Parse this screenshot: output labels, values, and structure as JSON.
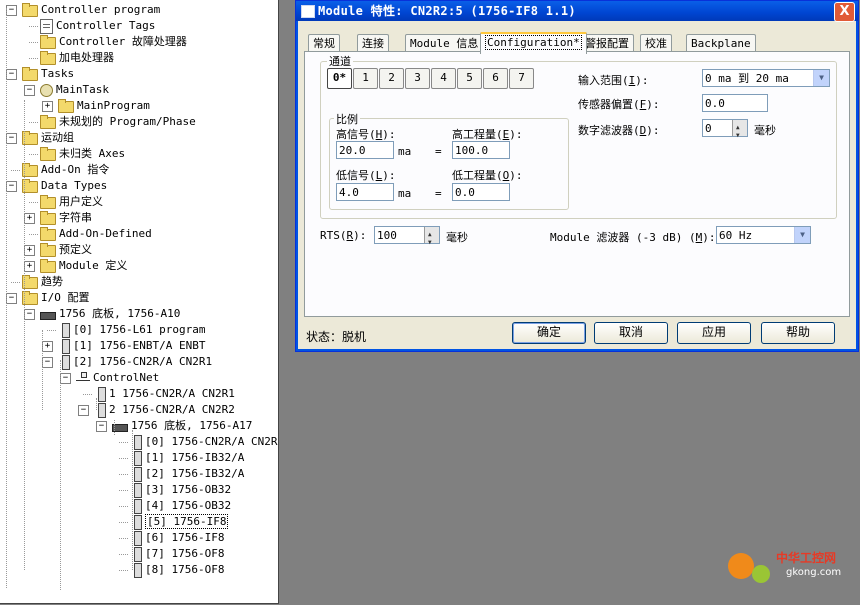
{
  "tree": {
    "items": [
      {
        "label": "Controller program",
        "icon": "folder-icon"
      },
      {
        "label": "Controller Tags",
        "icon": "tags-icon"
      },
      {
        "label": "Controller 故障处理器",
        "icon": "folder-icon"
      },
      {
        "label": "加电处理器",
        "icon": "folder-icon"
      },
      {
        "label": "Tasks",
        "icon": "folder-icon"
      },
      {
        "label": "MainTask",
        "icon": "task-icon"
      },
      {
        "label": "MainProgram",
        "icon": "program-icon"
      },
      {
        "label": "未规划的 Program/Phase",
        "icon": "folder-icon"
      },
      {
        "label": "运动组",
        "icon": "folder-icon"
      },
      {
        "label": "未归类 Axes",
        "icon": "folder-icon"
      },
      {
        "label": "Add-On 指令",
        "icon": "folder-icon"
      },
      {
        "label": "Data Types",
        "icon": "folder-icon"
      },
      {
        "label": "用户定义",
        "icon": "folder-icon"
      },
      {
        "label": "字符串",
        "icon": "folder-icon"
      },
      {
        "label": "Add-On-Defined",
        "icon": "folder-icon"
      },
      {
        "label": "预定义",
        "icon": "folder-icon"
      },
      {
        "label": "Module 定义",
        "icon": "folder-icon"
      },
      {
        "label": "趋势",
        "icon": "folder-icon"
      },
      {
        "label": "I/O 配置",
        "icon": "folder-icon"
      },
      {
        "label": "1756 底板, 1756-A10",
        "icon": "chassis-icon"
      },
      {
        "label": "[0] 1756-L61 program",
        "icon": "module-icon"
      },
      {
        "label": "[1] 1756-ENBT/A ENBT",
        "icon": "module-icon"
      },
      {
        "label": "[2] 1756-CN2R/A CN2R1",
        "icon": "module-icon"
      },
      {
        "label": "ControlNet",
        "icon": "network-icon"
      },
      {
        "label": "1 1756-CN2R/A CN2R1",
        "icon": "module-icon"
      },
      {
        "label": "2 1756-CN2R/A CN2R2",
        "icon": "module-icon"
      },
      {
        "label": "1756 底板, 1756-A17",
        "icon": "chassis-icon"
      },
      {
        "label": "[0] 1756-CN2R/A CN2R",
        "icon": "module-icon"
      },
      {
        "label": "[1] 1756-IB32/A",
        "icon": "module-icon"
      },
      {
        "label": "[2] 1756-IB32/A",
        "icon": "module-icon"
      },
      {
        "label": "[3] 1756-OB32",
        "icon": "module-icon"
      },
      {
        "label": "[4] 1756-OB32",
        "icon": "module-icon"
      },
      {
        "label": "[5] 1756-IF8",
        "icon": "module-icon"
      },
      {
        "label": "[6] 1756-IF8",
        "icon": "module-icon"
      },
      {
        "label": "[7] 1756-OF8",
        "icon": "module-icon"
      },
      {
        "label": "[8] 1756-OF8",
        "icon": "module-icon"
      }
    ]
  },
  "dialog": {
    "title": "Module 特性: CN2R2:5 (1756-IF8 1.1)",
    "close_glyph": "X",
    "tabs": [
      "常规",
      "连接",
      "Module 信息",
      "Configuration*",
      "警报配置",
      "校准",
      "Backplane"
    ],
    "active_tab": "Configuration*",
    "channel_group_label": "通道",
    "channels": [
      "0*",
      "1",
      "2",
      "3",
      "4",
      "5",
      "6",
      "7"
    ],
    "scaling": {
      "group_label": "比例",
      "high_signal_label": "高信号",
      "high_signal_key": "H",
      "high_signal_value": "20.0",
      "high_eng_label": "高工程量",
      "high_eng_key": "E",
      "high_eng_value": "100.0",
      "low_signal_label": "低信号",
      "low_signal_key": "L",
      "low_signal_value": "4.0",
      "low_eng_label": "低工程量",
      "low_eng_key": "O",
      "low_eng_value": "0.0",
      "unit": "ma",
      "equals": "="
    },
    "input_range_label": "输入范围",
    "input_range_key": "I",
    "input_range_value": "0 ma 到 20 ma",
    "sensor_offset_label": "传感器偏置",
    "sensor_offset_key": "F",
    "sensor_offset_value": "0.0",
    "digital_filter_label": "数字滤波器",
    "digital_filter_key": "D",
    "digital_filter_value": "0",
    "digital_filter_unit": "毫秒",
    "rts_label": "RTS",
    "rts_key": "R",
    "rts_value": "100",
    "rts_unit": "毫秒",
    "module_filter_label": "Module 滤波器 (-3 dB)",
    "module_filter_key": "M",
    "module_filter_value": "60 Hz",
    "status_label": "状态：",
    "status_value": "脱机",
    "buttons": {
      "ok": "确定",
      "cancel": "取消",
      "apply": "应用",
      "help": "帮助"
    }
  },
  "watermark": {
    "text1": "中华工控网",
    "text2": "gkong.com"
  }
}
